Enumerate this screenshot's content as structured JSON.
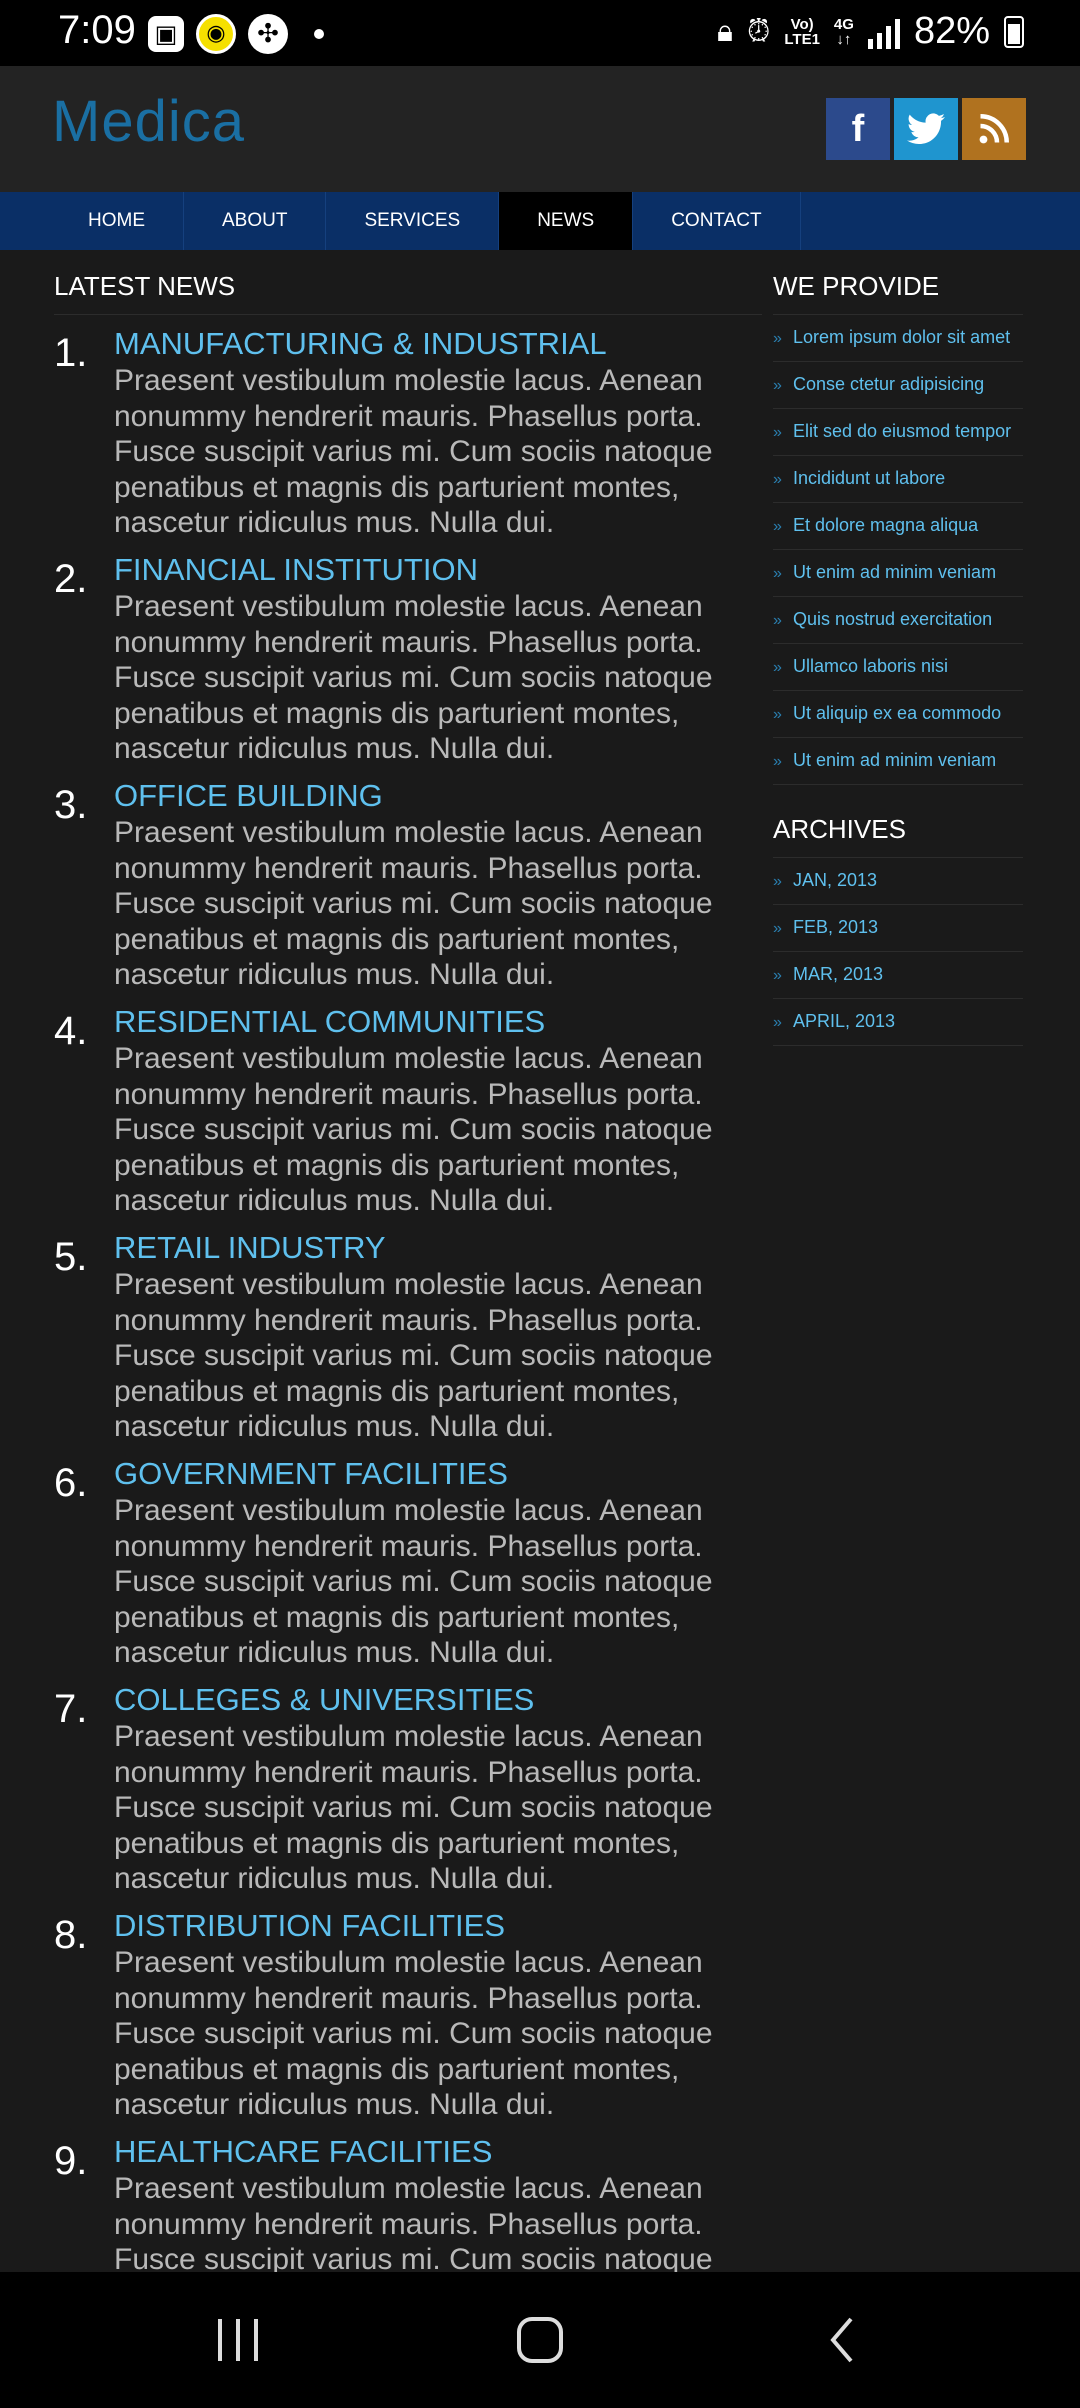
{
  "status_bar": {
    "time": "7:09",
    "network_top": "Vo)",
    "network_bottom": "LTE1",
    "gen": "4G",
    "battery": "82%"
  },
  "header": {
    "logo": "Medica",
    "social": {
      "facebook": "f",
      "rss": "≡"
    }
  },
  "nav": {
    "items": [
      "HOME",
      "ABOUT",
      "SERVICES",
      "NEWS",
      "CONTACT"
    ],
    "active": "NEWS"
  },
  "main": {
    "title": "LATEST NEWS",
    "news": [
      {
        "num": "1.",
        "title": "MANUFACTURING & INDUSTRIAL",
        "body": "Praesent vestibulum molestie lacus. Aenean nonummy hendrerit mauris. Phasellus porta. Fusce suscipit varius mi. Cum sociis natoque penatibus et magnis dis parturient montes, nascetur ridiculus mus. Nulla dui."
      },
      {
        "num": "2.",
        "title": "FINANCIAL INSTITUTION",
        "body": "Praesent vestibulum molestie lacus. Aenean nonummy hendrerit mauris. Phasellus porta. Fusce suscipit varius mi. Cum sociis natoque penatibus et magnis dis parturient montes, nascetur ridiculus mus. Nulla dui."
      },
      {
        "num": "3.",
        "title": "OFFICE BUILDING",
        "body": "Praesent vestibulum molestie lacus. Aenean nonummy hendrerit mauris. Phasellus porta. Fusce suscipit varius mi. Cum sociis natoque penatibus et magnis dis parturient montes, nascetur ridiculus mus. Nulla dui."
      },
      {
        "num": "4.",
        "title": "RESIDENTIAL COMMUNITIES",
        "body": "Praesent vestibulum molestie lacus. Aenean nonummy hendrerit mauris. Phasellus porta. Fusce suscipit varius mi. Cum sociis natoque penatibus et magnis dis parturient montes, nascetur ridiculus mus. Nulla dui."
      },
      {
        "num": "5.",
        "title": "RETAIL INDUSTRY",
        "body": "Praesent vestibulum molestie lacus. Aenean nonummy hendrerit mauris. Phasellus porta. Fusce suscipit varius mi. Cum sociis natoque penatibus et magnis dis parturient montes, nascetur ridiculus mus. Nulla dui."
      },
      {
        "num": "6.",
        "title": "GOVERNMENT FACILITIES",
        "body": "Praesent vestibulum molestie lacus. Aenean nonummy hendrerit mauris. Phasellus porta. Fusce suscipit varius mi. Cum sociis natoque penatibus et magnis dis parturient montes, nascetur ridiculus mus. Nulla dui."
      },
      {
        "num": "7.",
        "title": "COLLEGES & UNIVERSITIES",
        "body": "Praesent vestibulum molestie lacus. Aenean nonummy hendrerit mauris. Phasellus porta. Fusce suscipit varius mi. Cum sociis natoque penatibus et magnis dis parturient montes, nascetur ridiculus mus. Nulla dui."
      },
      {
        "num": "8.",
        "title": "DISTRIBUTION FACILITIES",
        "body": "Praesent vestibulum molestie lacus. Aenean nonummy hendrerit mauris. Phasellus porta. Fusce suscipit varius mi. Cum sociis natoque penatibus et magnis dis parturient montes, nascetur ridiculus mus. Nulla dui."
      },
      {
        "num": "9.",
        "title": "HEALTHCARE FACILITIES",
        "body": "Praesent vestibulum molestie lacus. Aenean nonummy hendrerit mauris. Phasellus porta. Fusce suscipit varius mi. Cum sociis natoque penatibus et magnis dis parturient montes, nascetur ridiculus mus. Nulla dui."
      }
    ]
  },
  "sidebar": {
    "provide_title": "WE PROVIDE",
    "provide_items": [
      "Lorem ipsum dolor sit amet",
      "Conse ctetur adipisicing",
      "Elit sed do eiusmod tempor",
      "Incididunt ut labore",
      "Et dolore magna aliqua",
      "Ut enim ad minim veniam",
      "Quis nostrud exercitation",
      "Ullamco laboris nisi",
      "Ut aliquip ex ea commodo",
      "Ut enim ad minim veniam"
    ],
    "archives_title": "ARCHIVES",
    "archives": [
      "JAN, 2013",
      "FEB, 2013",
      "MAR, 2013",
      "APRIL, 2013"
    ]
  },
  "colors": {
    "accent": "#5fc0ee",
    "nav_bg": "#0a2f66",
    "logo": "#1a6fa3",
    "facebook": "#2c4a8c",
    "twitter": "#1f95cf",
    "rss": "#b0721f"
  },
  "icons": {
    "status_left": [
      "gallery-icon",
      "camera-circle-icon",
      "fan-icon",
      "dot-icon"
    ],
    "status_right": [
      "lock-icon",
      "alarm-icon",
      "signal-icon",
      "battery-icon"
    ],
    "android_nav": [
      "recents-icon",
      "home-icon",
      "back-icon"
    ]
  }
}
